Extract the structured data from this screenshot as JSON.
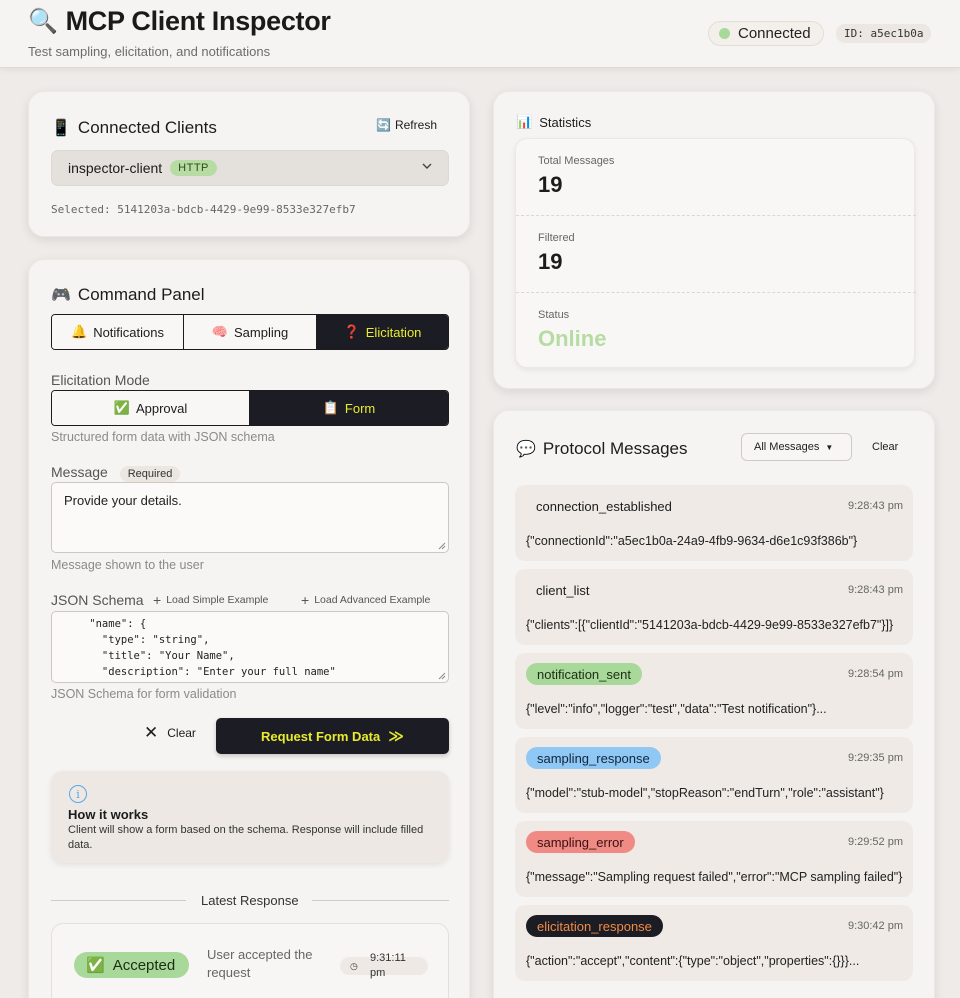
{
  "header": {
    "title_icon": "magnifier-icon",
    "title": "MCP Client Inspector",
    "subtitle": "Test sampling, elicitation, and notifications",
    "status": "Connected",
    "connection_id": "ID: a5ec1b0a",
    "status_color": "#a8d89a"
  },
  "clients": {
    "title": "Connected Clients",
    "refresh_label": "Refresh",
    "selected_client": "inspector-client",
    "transport_badge": "HTTP",
    "selected_text": "Selected: 5141203a-bdcb-4429-9e99-8533e327efb7"
  },
  "command": {
    "title": "Command Panel",
    "tabs": [
      {
        "icon": "🔔",
        "label": "Notifications",
        "active": false
      },
      {
        "icon": "🧠",
        "label": "Sampling",
        "active": false
      },
      {
        "icon": "❓",
        "label": "Elicitation",
        "active": true
      }
    ],
    "mode_label": "Elicitation Mode",
    "modes": [
      {
        "icon": "✅",
        "label": "Approval",
        "active": false
      },
      {
        "icon": "📋",
        "label": "Form",
        "active": true
      }
    ],
    "mode_help": "Structured form data with JSON schema",
    "message_label": "Message",
    "message_required": "Required",
    "message_value": "Provide your details.",
    "message_help": "Message shown to the user",
    "schema_label": "JSON Schema",
    "load_simple": "Load Simple Example",
    "load_advanced": "Load Advanced Example",
    "schema_lines": [
      "    \"name\": {",
      "      \"type\": \"string\",",
      "      \"title\": \"Your Name\",",
      "      \"description\": \"Enter your full name\"",
      "    },"
    ],
    "schema_help": "JSON Schema for form validation",
    "clear_label": "Clear",
    "submit_label": "Request Form Data",
    "info_title": "How it works",
    "info_text": "Client will show a form based on the schema. Response will include filled data.",
    "latest_response_label": "Latest Response",
    "response_status": "Accepted",
    "response_text": "User accepted the request",
    "response_time": "9:31:11 pm"
  },
  "stats": {
    "title": "Statistics",
    "total_label": "Total Messages",
    "total_value": "19",
    "filtered_label": "Filtered",
    "filtered_value": "19",
    "status_label": "Status",
    "status_value": "Online"
  },
  "messages": {
    "title": "Protocol Messages",
    "filter_value": "All Messages",
    "clear_label": "Clear",
    "items": [
      {
        "type": "connection_established",
        "time": "9:28:43 pm",
        "body": "{\"connectionId\":\"a5ec1b0a-24a9-4fb9-9634-d6e1c93f386b\"}",
        "pill": null,
        "text_color": "#1c1c1c"
      },
      {
        "type": "client_list",
        "time": "9:28:43 pm",
        "body": "{\"clients\":[{\"clientId\":\"5141203a-bdcb-4429-9e99-8533e327efb7\"}]}",
        "pill": null,
        "text_color": "#1c1c1c"
      },
      {
        "type": "notification_sent",
        "time": "9:28:54 pm",
        "body": "{\"level\":\"info\",\"logger\":\"test\",\"data\":\"Test notification\"}...",
        "pill": "#a8d89a",
        "text_color": "#1c2d14"
      },
      {
        "type": "sampling_response",
        "time": "9:29:35 pm",
        "body": "{\"model\":\"stub-model\",\"stopReason\":\"endTurn\",\"role\":\"assistant\"}",
        "pill": "#8fc7f5",
        "text_color": "#10263a"
      },
      {
        "type": "sampling_error",
        "time": "9:29:52 pm",
        "body": "{\"message\":\"Sampling request failed\",\"error\":\"MCP sampling failed\"}",
        "pill": "#f08a85",
        "text_color": "#3a1010"
      },
      {
        "type": "elicitation_response",
        "time": "9:30:42 pm",
        "body": "{\"action\":\"accept\",\"content\":{\"type\":\"object\",\"properties\":{}}}...",
        "pill": "#1c1c25",
        "text_color": "#f08b45"
      }
    ]
  }
}
